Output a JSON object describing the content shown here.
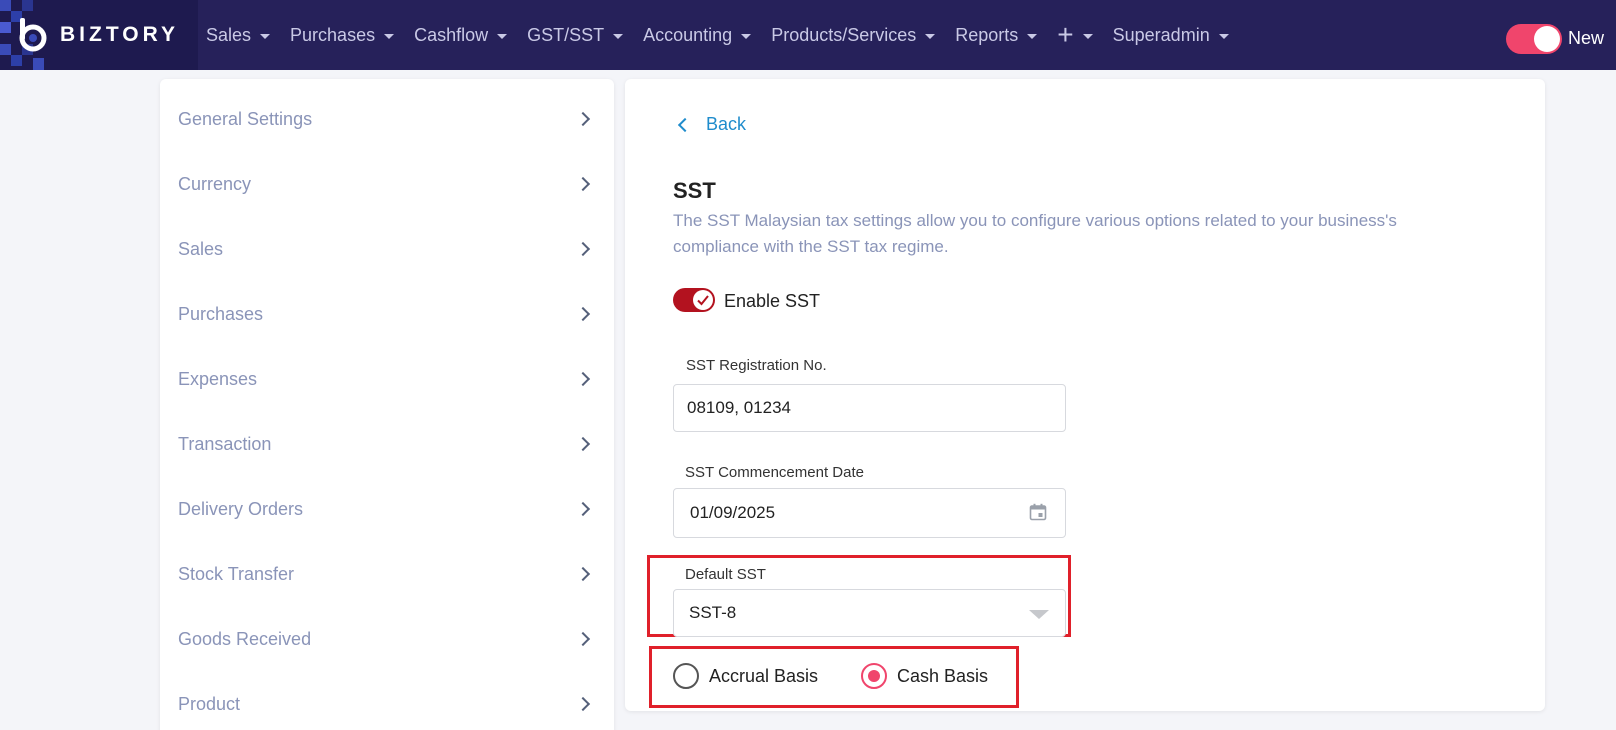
{
  "header": {
    "brand": "BIZTORY",
    "nav": [
      {
        "label": "Sales",
        "dropdown": true
      },
      {
        "label": "Purchases",
        "dropdown": true
      },
      {
        "label": "Cashflow",
        "dropdown": true
      },
      {
        "label": "GST/SST",
        "dropdown": true
      },
      {
        "label": "Accounting",
        "dropdown": true
      },
      {
        "label": "Products/Services",
        "dropdown": true
      },
      {
        "label": "Reports",
        "dropdown": true
      }
    ],
    "plus_icon": "plus-icon",
    "user": "Superadmin",
    "new_toggle": {
      "label": "New",
      "on": true
    },
    "colors": {
      "bar": "#26215a",
      "accent": "#f0456c"
    }
  },
  "sidebar": {
    "items": [
      {
        "label": "General Settings"
      },
      {
        "label": "Currency"
      },
      {
        "label": "Sales"
      },
      {
        "label": "Purchases"
      },
      {
        "label": "Expenses"
      },
      {
        "label": "Transaction"
      },
      {
        "label": "Delivery Orders"
      },
      {
        "label": "Stock Transfer"
      },
      {
        "label": "Goods Received"
      },
      {
        "label": "Product"
      }
    ]
  },
  "main": {
    "back_label": "Back",
    "title": "SST",
    "description": "The SST Malaysian tax settings allow you to configure various options related to your business's compliance with the SST tax regime.",
    "enable_sst": {
      "label": "Enable SST",
      "on": true,
      "color": "#b3121f"
    },
    "registration": {
      "label": "SST Registration No.",
      "value": "08109, 01234"
    },
    "commencement": {
      "label": "SST Commencement Date",
      "value": "01/09/2025"
    },
    "default_sst": {
      "label": "Default SST",
      "value": "SST-8"
    },
    "basis": {
      "options": [
        {
          "label": "Accrual Basis",
          "selected": false
        },
        {
          "label": "Cash Basis",
          "selected": true
        }
      ]
    },
    "highlight_color": "#e0202a"
  }
}
